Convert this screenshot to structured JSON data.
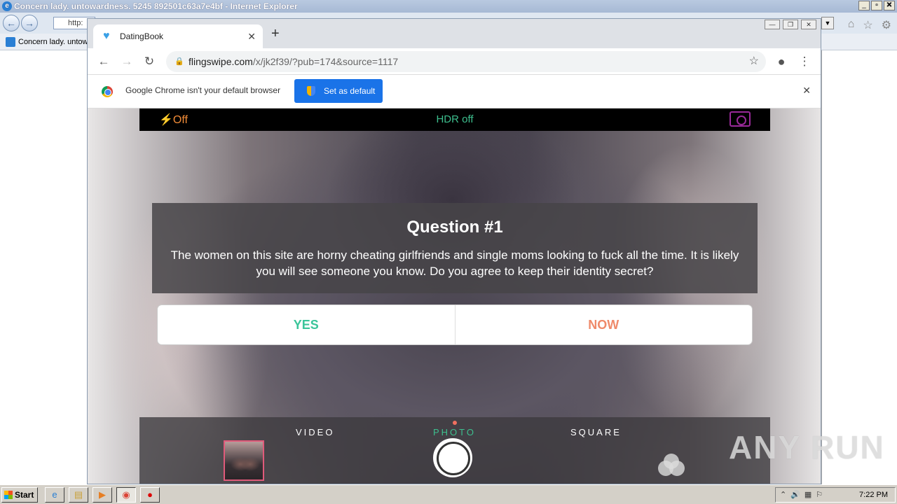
{
  "ie": {
    "title": "Concern lady. untowardness. 5245 892501c63a7e4bf - Internet Explorer",
    "address": "http:",
    "tab_label": "Concern lady. untowardness",
    "win_min": "_",
    "win_max": "▫",
    "win_close": "✕",
    "go": "▼"
  },
  "chrome": {
    "tab_title": "DatingBook",
    "tab_close": "✕",
    "new_tab": "+",
    "url_host": "flingswipe.com",
    "url_path": "/x/jk2f39/?pub=174&source=1117",
    "infobar_text": "Google Chrome isn't your default browser",
    "set_default_label": "Set as default",
    "info_close": "✕",
    "win_min": "—",
    "win_max": "❐",
    "win_close": "✕"
  },
  "page": {
    "flash_label": "Off",
    "hdr_label": "HDR off",
    "question_title": "Question #1",
    "question_text": "The women on this site are horny cheating girlfriends and single moms looking to fuck all the time. It is likely you will see someone you know. Do you agree to keep their identity secret?",
    "answer_yes": "YES",
    "answer_no": "NOW",
    "modes": [
      "VIDEO",
      "PHOTO",
      "SQUARE"
    ],
    "active_mode": "PHOTO"
  },
  "watermark": "ANY RUN",
  "taskbar": {
    "start_label": "Start",
    "clock": "7:22 PM"
  }
}
